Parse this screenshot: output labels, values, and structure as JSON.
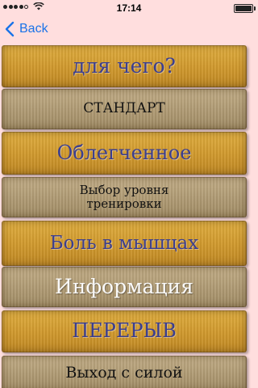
{
  "status_bar": {
    "time": "17:14",
    "signal_dots": [
      true,
      true,
      true,
      true,
      false
    ]
  },
  "nav": {
    "back_label": "Back"
  },
  "colors": {
    "background": "#ffdede",
    "accent": "#1a73e8",
    "gold_button": "#d19a2e",
    "beige_button": "#b09b74"
  },
  "menu": [
    {
      "label": "для чего?",
      "style": "gold"
    },
    {
      "label": "СТАНДАРТ",
      "style": "beige"
    },
    {
      "label": "Облегченное",
      "style": "gold"
    },
    {
      "label": "Выбор уровня\nтренировки",
      "style": "beige"
    },
    {
      "label": "Боль в мышцах",
      "style": "gold"
    },
    {
      "label": "Информация",
      "style": "beige"
    },
    {
      "label": "ПЕРЕРЫВ",
      "style": "gold"
    },
    {
      "label": "Выход с силой",
      "style": "beige"
    }
  ]
}
